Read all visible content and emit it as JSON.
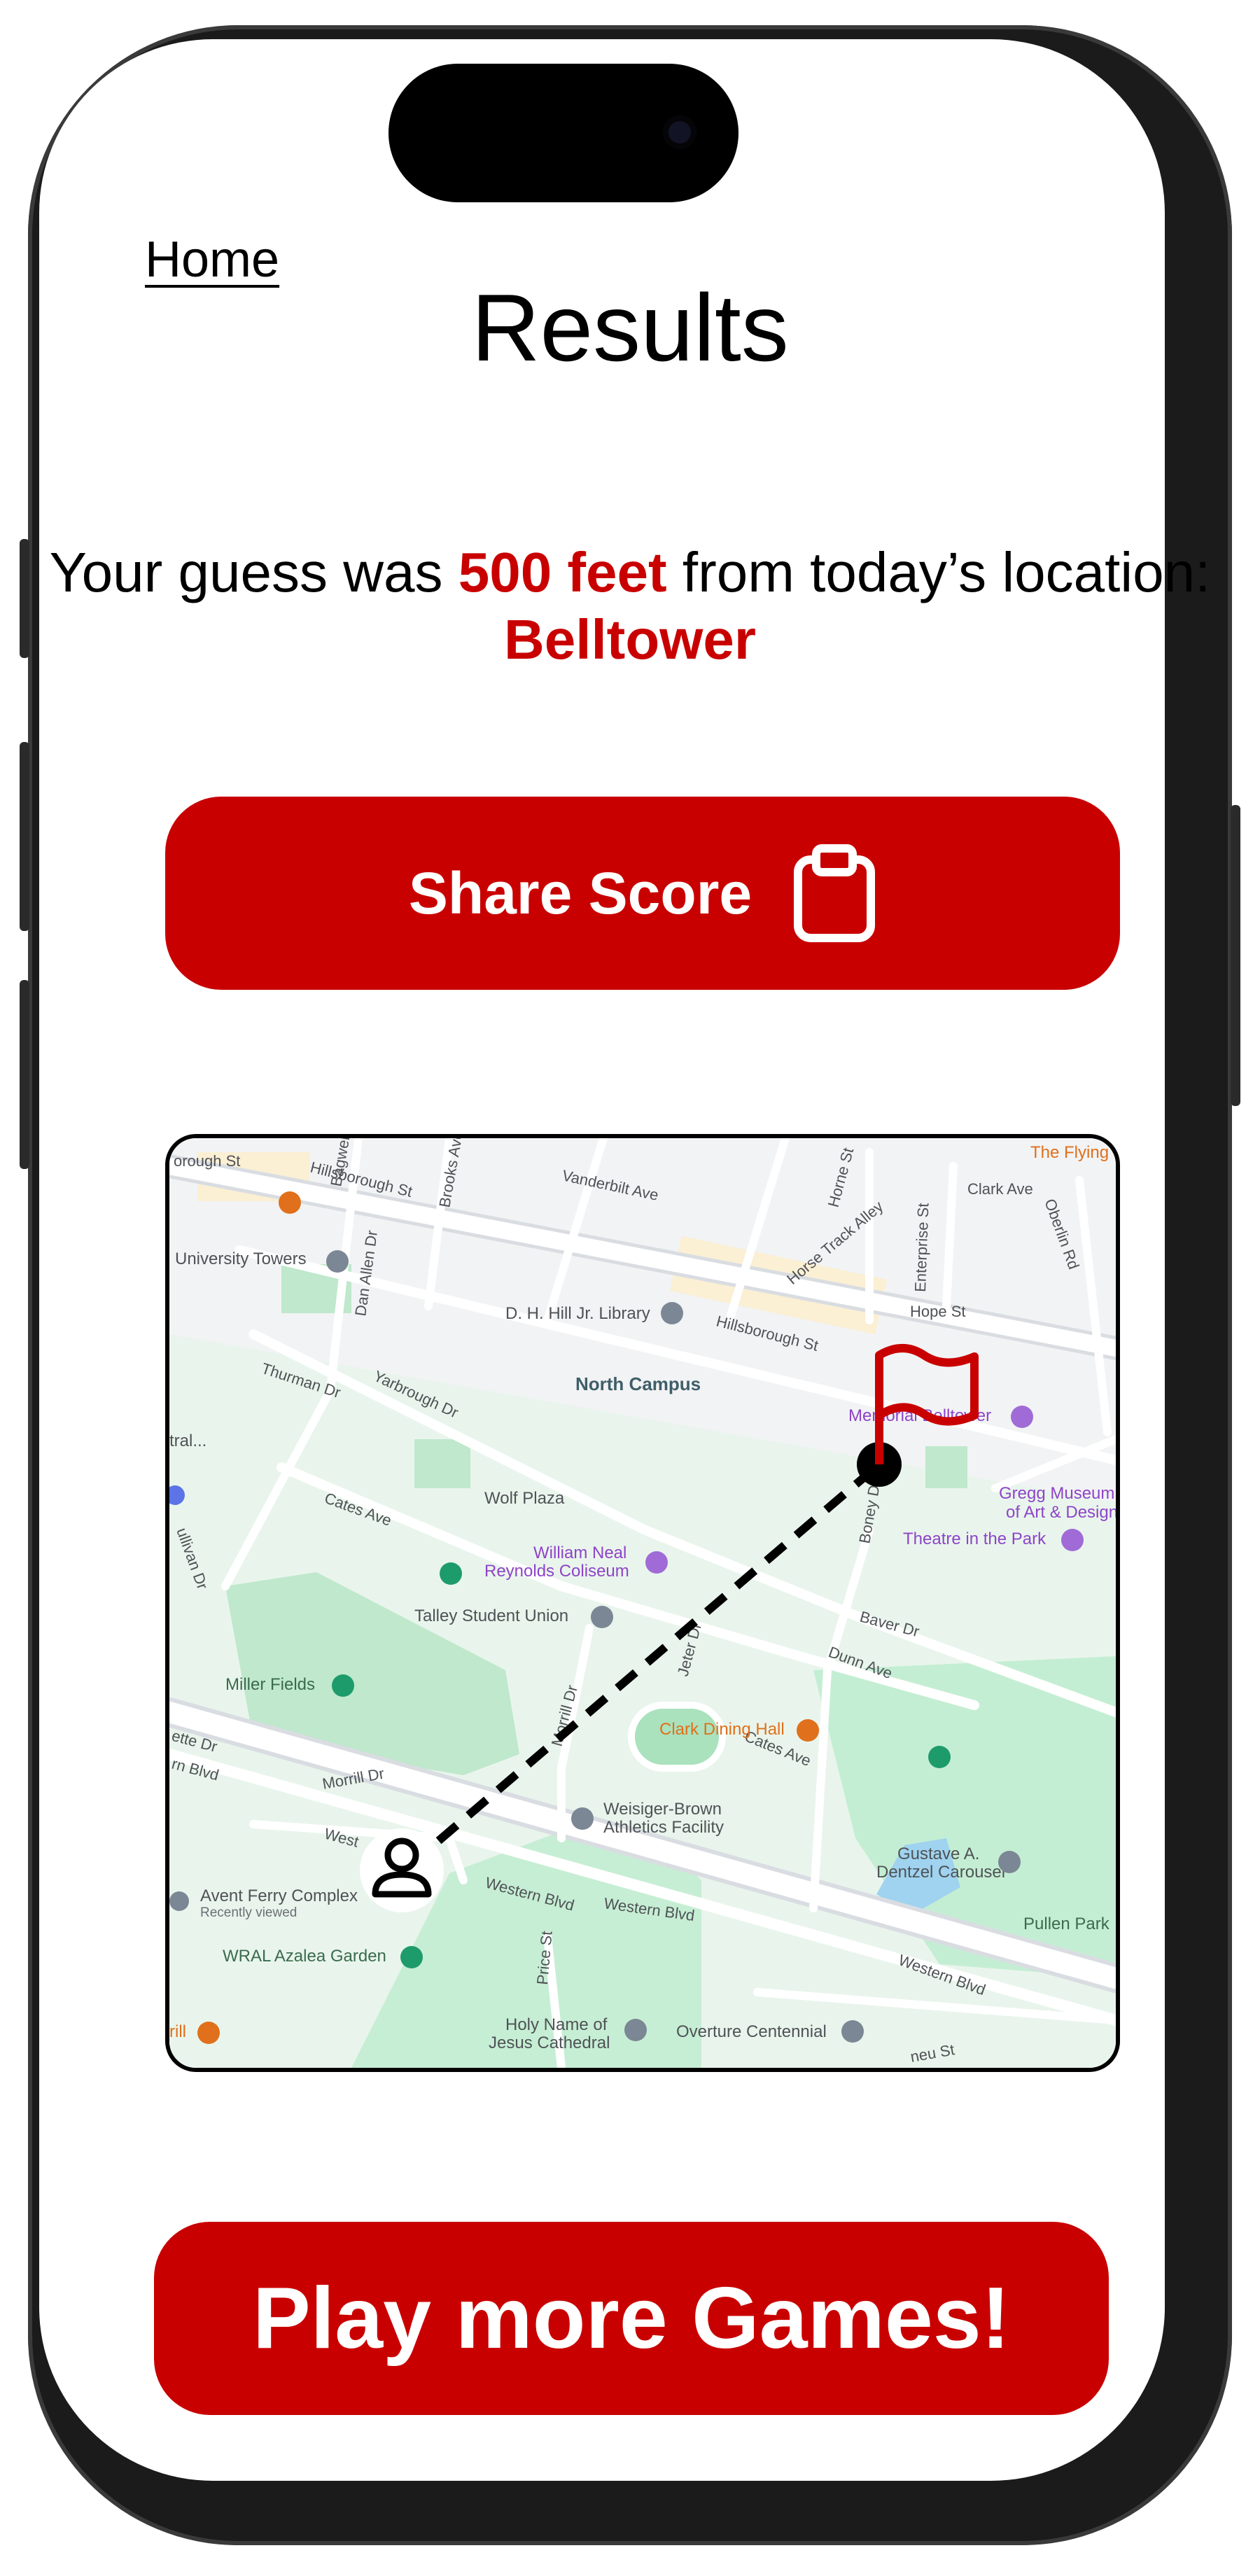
{
  "nav": {
    "home_label": "Home"
  },
  "page": {
    "title": "Results"
  },
  "result": {
    "prefix": "Your guess was ",
    "distance": "500 feet",
    "middle": " from today’s location: ",
    "location": "Belltower"
  },
  "share": {
    "label": "Share Score",
    "icon": "clipboard-icon"
  },
  "map": {
    "labels": {
      "hillsborough_st_top": "Hillsborough St",
      "borough_st": "orough St",
      "vanderbilt_ave": "Vanderbilt Ave",
      "bagwell": "Bagwell",
      "brooks_ave": "Brooks Ave",
      "horse_track_alley": "Horse Track Alley",
      "horne_st": "Horne St",
      "clark_ave": "Clark Ave",
      "oberlin_rd": "Oberlin Rd",
      "the_flying": "The Flying",
      "university_towers": "University Towers",
      "dan_allen_dr": "Dan Allen Dr",
      "dh_hill_library": "D. H. Hill Jr. Library",
      "hillsborough_st_mid": "Hillsborough St",
      "hope_st": "Hope St",
      "enterprise_st": "Enterprise St",
      "thurman_dr": "Thurman Dr",
      "yarbrough_dr": "Yarbrough Dr",
      "north_campus": "North Campus",
      "memorial_belltower": "Memorial Belltower",
      "tral": "tral...",
      "wolf_plaza": "Wolf Plaza",
      "cates_ave_left": "Cates Ave",
      "gregg_museum_1": "Gregg Museum",
      "gregg_museum_2": "of Art & Design",
      "theatre_in_the_park": "Theatre in the Park",
      "boney_dr": "Boney Dr",
      "william_neal_1": "William Neal",
      "william_neal_2": "Reynolds Coliseum",
      "sullivan_dr": "ullivan Dr",
      "talley_student_union": "Talley Student Union",
      "bayer_dr": "Baver Dr",
      "dunn_ave": "Dunn Ave",
      "jeter_dr": "Jeter Dr",
      "miller_fields": "Miller Fields",
      "morrill_dr": "Morrill Dr",
      "clark_dining_hall": "Clark Dining Hall",
      "cates_ave_right": "Cates Ave",
      "morrill_dr_lower": "Morrill Dr",
      "rn_blvd": "rn Blvd",
      "ette_dr": "ette Dr",
      "weisiger_1": "Weisiger-Brown",
      "weisiger_2": "Athletics Facility",
      "west": "West",
      "gustave_1": "Gustave A.",
      "gustave_2": "Dentzel Carousel",
      "western_blvd_1": "Western Blvd",
      "western_blvd_2": "Western Blvd",
      "western_blvd_3": "Western Blvd",
      "avent_ferry": "Avent Ferry Complex",
      "recently_viewed": "Recently viewed",
      "pullen_park": "Pullen Park",
      "wral_azalea": "WRAL Azalea Garden",
      "price_st": "Price St",
      "holy_name_1": "Holy Name of",
      "holy_name_2": "Jesus Cathedral",
      "overture_centennial": "Overture Centennial",
      "ill": "rill",
      "neu_st": "neu St"
    },
    "flag_color": "#c90000",
    "guess_marker_icon": "person-icon",
    "target_marker_icon": "flag-icon"
  },
  "play": {
    "label": "Play more Games!"
  },
  "colors": {
    "accent": "#c90000",
    "map_bg": "#f2f3f4",
    "park": "#d2f2dd",
    "road": "#ffffff"
  }
}
